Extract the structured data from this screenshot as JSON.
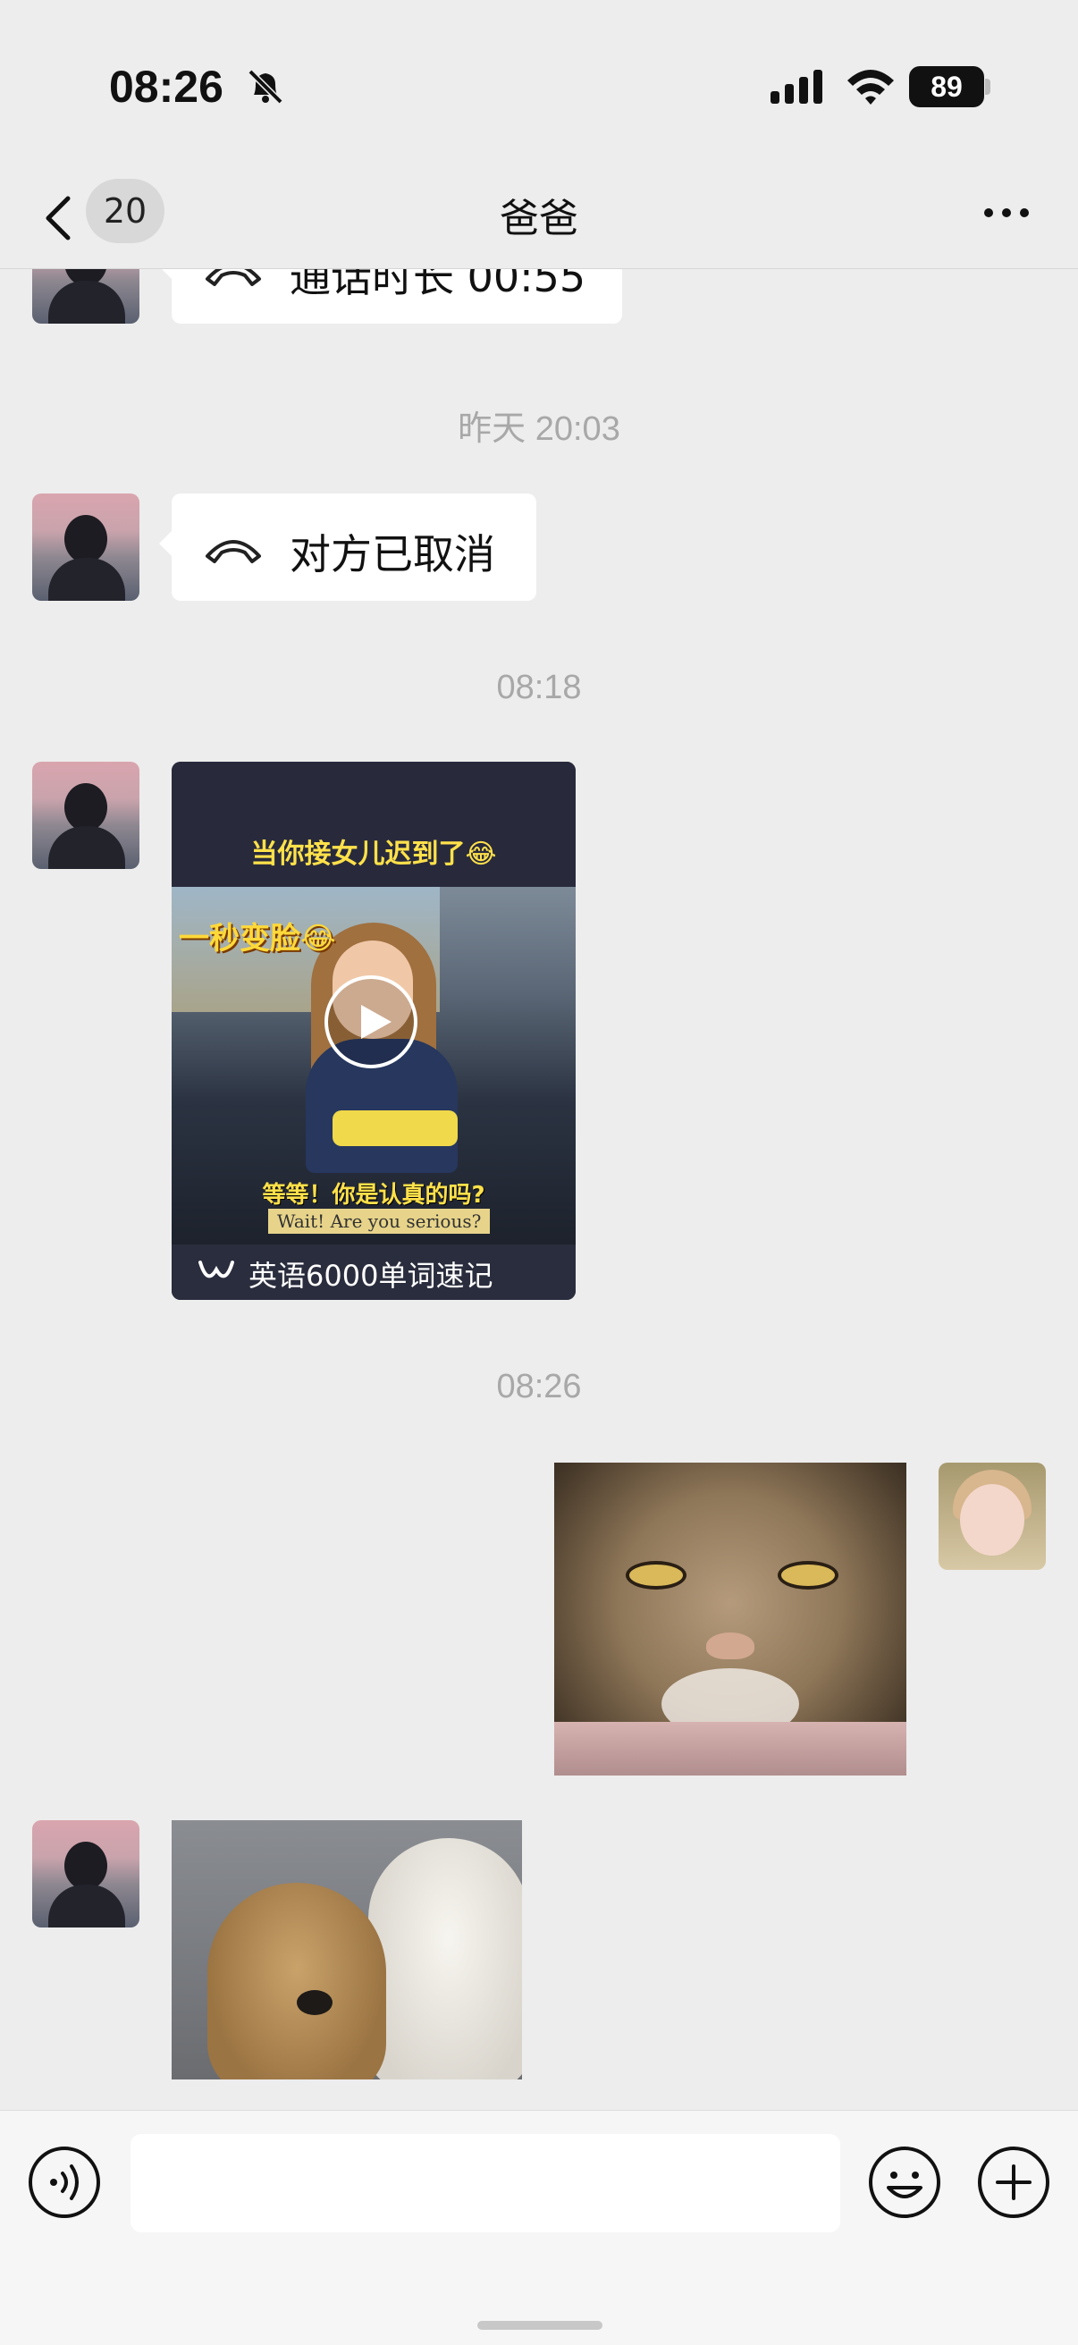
{
  "status_bar": {
    "time": "08:26",
    "battery": "89"
  },
  "nav": {
    "back_count": "20",
    "title": "爸爸"
  },
  "messages": {
    "call_duration": "通话时长 00:55",
    "ts1": "昨天 20:03",
    "call_cancelled": "对方已取消",
    "ts2": "08:18",
    "video": {
      "caption_top": "当你接女儿迟到了😂",
      "label_left": "一秒变脸😂",
      "label_cn": "等等！你是认真的吗?",
      "label_en": "Wait!  Are you serious?",
      "source": "英语6000单词速记"
    },
    "ts3": "08:26"
  },
  "icons": {
    "back": "chevron-left-icon",
    "more": "more-dots-icon",
    "voice": "voice-icon",
    "emoji": "emoji-icon",
    "plus": "plus-icon",
    "phone": "phone-hangup-icon",
    "play": "play-icon"
  }
}
